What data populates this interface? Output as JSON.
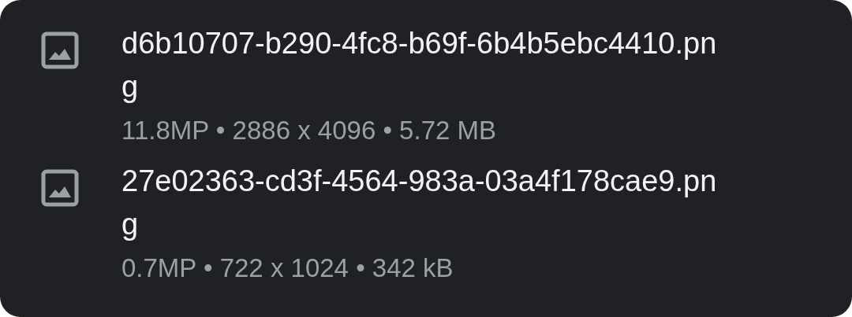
{
  "files": [
    {
      "name": "d6b10707-b290-4fc8-b69f-6b4b5ebc4410.png",
      "details": "11.8MP • 2886 x 4096 • 5.72 MB"
    },
    {
      "name": "27e02363-cd3f-4564-983a-03a4f178cae9.png",
      "details": "0.7MP • 722 x 1024 • 342 kB"
    }
  ]
}
